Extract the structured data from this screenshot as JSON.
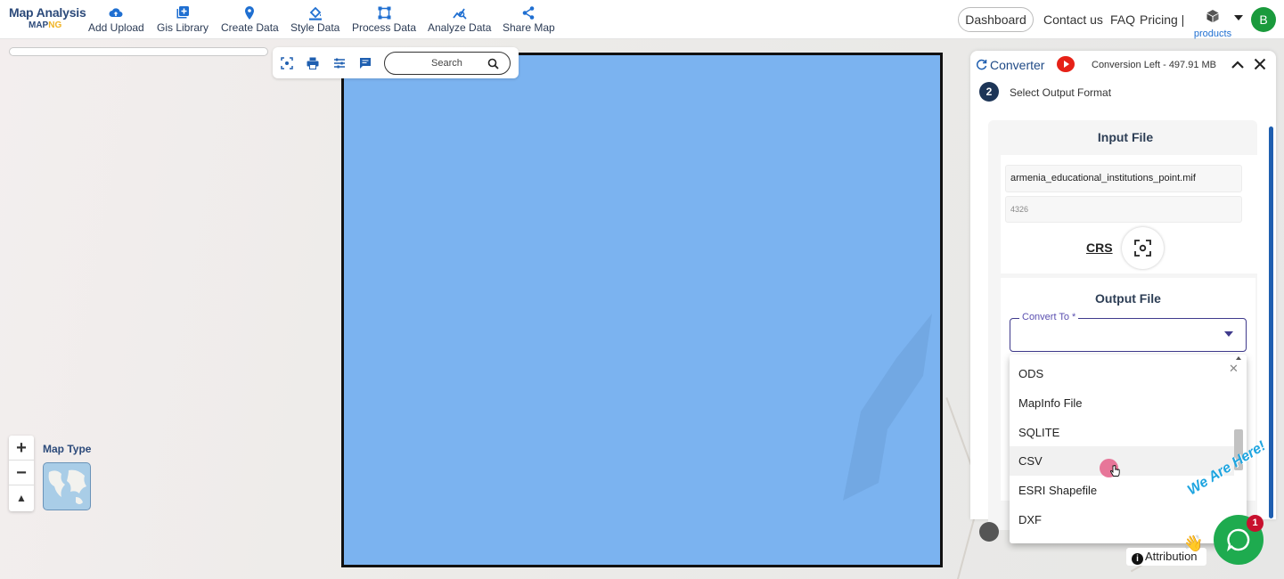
{
  "logo": {
    "line1": "Map Analysis",
    "line2_a": "MAP",
    "line2_b": "NG"
  },
  "nav": [
    {
      "label": "Add Upload",
      "icon": "cloud-upload-icon"
    },
    {
      "label": "Gis Library",
      "icon": "library-add-icon"
    },
    {
      "label": "Create Data",
      "icon": "location-pin-icon"
    },
    {
      "label": "Style Data",
      "icon": "paint-bucket-icon"
    },
    {
      "label": "Process Data",
      "icon": "process-nodes-icon"
    },
    {
      "label": "Analyze Data",
      "icon": "analyze-chart-icon"
    },
    {
      "label": "Share Map",
      "icon": "share-icon"
    }
  ],
  "header": {
    "dashboard": "Dashboard",
    "contact": "Contact us",
    "faq": "FAQ",
    "pricing": "Pricing |",
    "products": "products",
    "avatar_initial": "B"
  },
  "toolbar": {
    "search_placeholder": "Search"
  },
  "map": {
    "map_type_label": "Map Type",
    "polygon_color": "#7bb3f0"
  },
  "converter": {
    "title": "Converter",
    "conversion_left": "Conversion Left - 497.91 MB",
    "step_number": "2",
    "step_text": "Select Output Format",
    "input_heading": "Input File",
    "input_filename": "armenia_educational_institutions_point.mif",
    "input_crs": "4326",
    "crs_label": "CRS",
    "output_heading": "Output File",
    "convert_to_label": "Convert To *",
    "options": [
      "ODS",
      "MapInfo File",
      "SQLITE",
      "CSV",
      "ESRI Shapefile",
      "DXF"
    ],
    "highlighted_option": "CSV"
  },
  "footer": {
    "attribution": "Attribution",
    "chat_badge": "1",
    "we_are_here": "We Are Here!"
  },
  "colors": {
    "accent": "#1f6fd1",
    "brand": "#2c4a7a",
    "chat": "#1eab4f",
    "badge": "#c8102e"
  }
}
